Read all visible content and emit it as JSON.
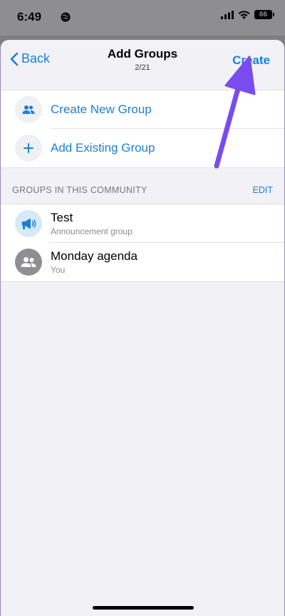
{
  "status": {
    "time": "6:49",
    "battery": "66"
  },
  "nav": {
    "back_label": "Back",
    "title": "Add Groups",
    "subtitle": "2/21",
    "create_label": "Create"
  },
  "actions": [
    {
      "label": "Create New Group",
      "icon": "people-icon"
    },
    {
      "label": "Add Existing Group",
      "icon": "plus-icon"
    }
  ],
  "section": {
    "title": "GROUPS IN THIS COMMUNITY",
    "edit_label": "EDIT"
  },
  "groups": [
    {
      "name": "Test",
      "subtitle": "Announcement group",
      "icon": "megaphone-icon"
    },
    {
      "name": "Monday agenda",
      "subtitle": "You",
      "icon": "group-avatar-icon"
    }
  ],
  "colors": {
    "accent": "#1c7fd6",
    "annotation_arrow": "#7a4cf0"
  }
}
